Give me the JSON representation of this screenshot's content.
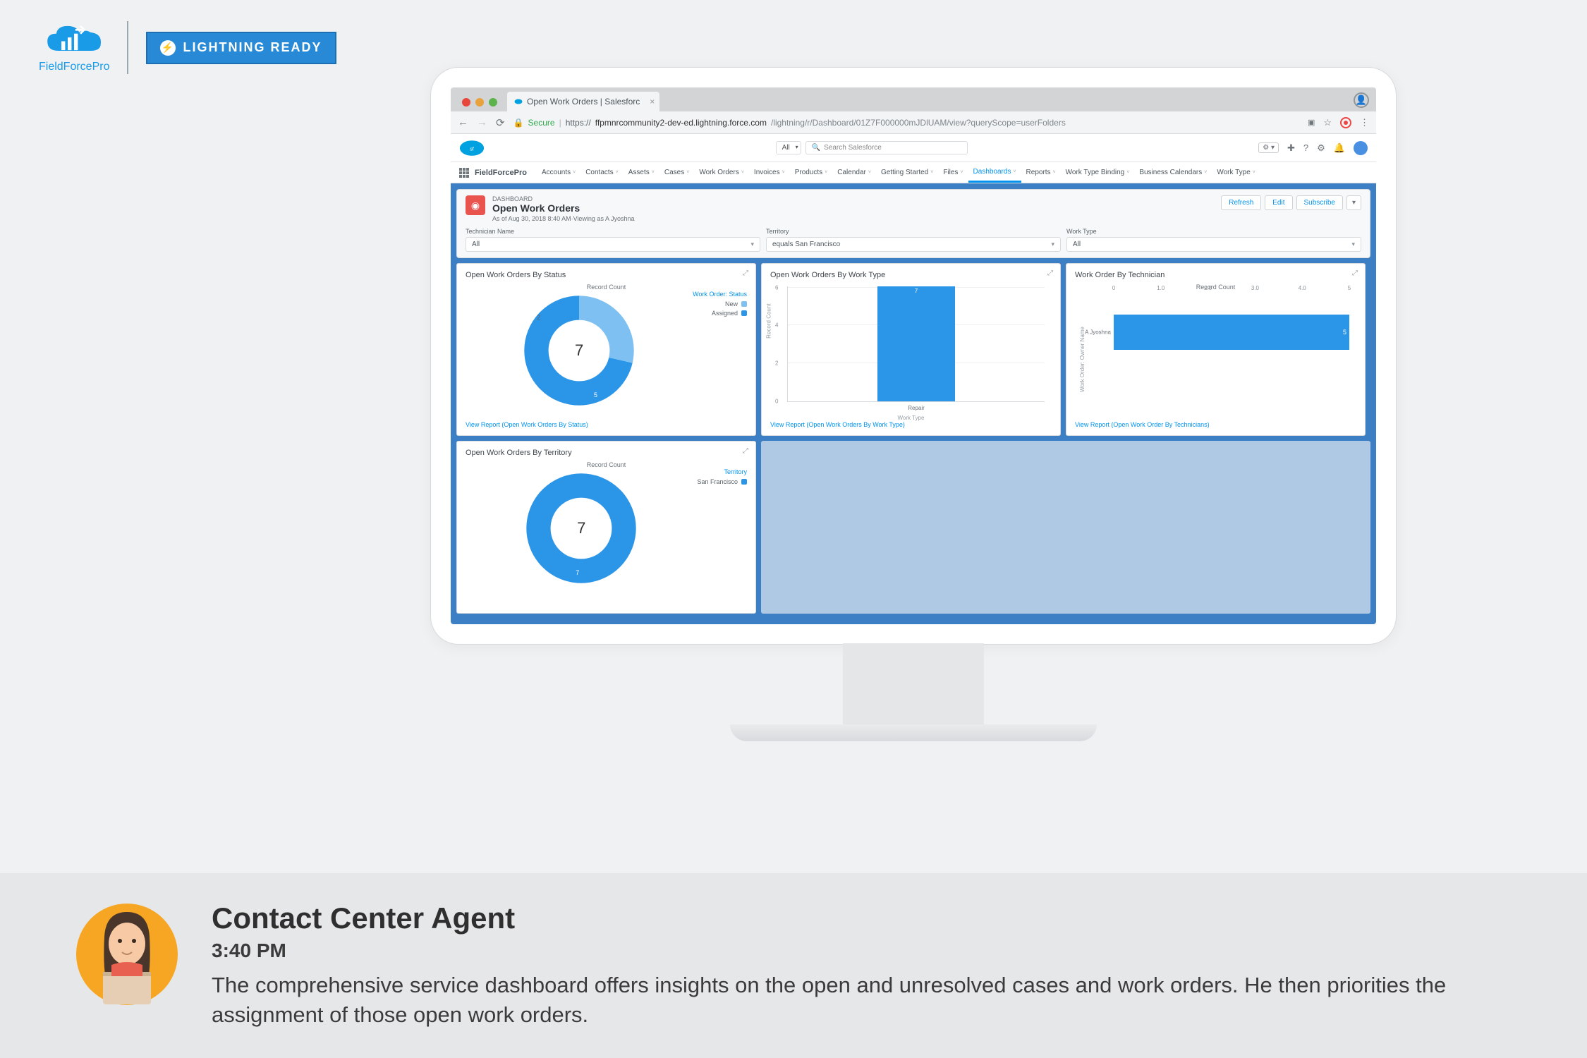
{
  "brand": {
    "name": "FieldForcePro",
    "badge": "LIGHTNING READY"
  },
  "browser": {
    "tab_title": "Open Work Orders | Salesforc",
    "url_secure_label": "Secure",
    "url_host": "ffpmnrcommunity2-dev-ed.lightning.force.com",
    "url_path": "/lightning/r/Dashboard/01Z7F000000mJDlUAM/view?queryScope=userFolders"
  },
  "sf_header": {
    "search_all": "All",
    "search_placeholder": "Search Salesforce",
    "setup_pill": "⚙ ▾"
  },
  "sf_nav": {
    "app": "FieldForcePro",
    "items": [
      "Accounts",
      "Contacts",
      "Assets",
      "Cases",
      "Work Orders",
      "Invoices",
      "Products",
      "Calendar",
      "Getting Started",
      "Files",
      "Dashboards",
      "Reports",
      "Work Type Binding",
      "Business Calendars",
      "Work Type"
    ],
    "active_index": 10
  },
  "dashboard": {
    "kicker": "DASHBOARD",
    "title": "Open Work Orders",
    "subtitle": "As of Aug 30, 2018 8:40 AM·Viewing as A Jyoshna",
    "actions": {
      "refresh": "Refresh",
      "edit": "Edit",
      "subscribe": "Subscribe"
    },
    "filters": [
      {
        "label": "Technician Name",
        "value": "All"
      },
      {
        "label": "Territory",
        "value": "equals San Francisco"
      },
      {
        "label": "Work Type",
        "value": "All"
      }
    ]
  },
  "cards": {
    "status": {
      "title": "Open Work Orders By Status",
      "metric_label": "Record Count",
      "legend_title": "Work Order: Status",
      "link": "View Report (Open Work Orders By Status)",
      "total": "7",
      "segments": [
        {
          "label": "New",
          "value": 2,
          "color": "#7ec0f2"
        },
        {
          "label": "Assigned",
          "value": 5,
          "color": "#2b95e8"
        }
      ]
    },
    "worktype": {
      "title": "Open Work Orders By Work Type",
      "link": "View Report (Open Work Orders By Work Type)",
      "y_label": "Record Count",
      "x_label": "Work Type",
      "category": "Repair",
      "value": "7",
      "y_ticks": [
        "0",
        "2",
        "4",
        "6"
      ]
    },
    "technician": {
      "title": "Work Order By Technician",
      "metric_label": "Record Count",
      "link": "View Report (Open Work Order By Technicians)",
      "y_label": "Work Order: Owner Name",
      "category": "A Jyoshna",
      "value": "5",
      "x_ticks": [
        "0",
        "1.0",
        "2.0",
        "3.0",
        "4.0",
        "5"
      ]
    },
    "territory": {
      "title": "Open Work Orders By Territory",
      "metric_label": "Record Count",
      "legend_title": "Territory",
      "total": "7",
      "segments": [
        {
          "label": "San Francisco",
          "value": 7,
          "color": "#2b95e8"
        }
      ]
    }
  },
  "chart_data": [
    {
      "type": "pie",
      "title": "Open Work Orders By Status",
      "categories": [
        "New",
        "Assigned"
      ],
      "values": [
        2,
        5
      ],
      "total": 7
    },
    {
      "type": "bar",
      "title": "Open Work Orders By Work Type",
      "categories": [
        "Repair"
      ],
      "values": [
        7
      ],
      "ylabel": "Record Count",
      "xlabel": "Work Type",
      "ylim": [
        0,
        7
      ]
    },
    {
      "type": "bar",
      "title": "Work Order By Technician",
      "orientation": "horizontal",
      "categories": [
        "A Jyoshna"
      ],
      "values": [
        5
      ],
      "xlabel": "Record Count",
      "ylabel": "Work Order: Owner Name",
      "xlim": [
        0,
        5
      ]
    },
    {
      "type": "pie",
      "title": "Open Work Orders By Territory",
      "categories": [
        "San Francisco"
      ],
      "values": [
        7
      ],
      "total": 7
    }
  ],
  "caption": {
    "persona": "Contact Center Agent",
    "time": "3:40 PM",
    "message": "The comprehensive service dashboard offers insights on the open and unresolved cases and work orders. He then priorities the assignment of those open work orders."
  },
  "colors": {
    "accent": "#2b95e8",
    "nav_blue": "#0093ee"
  }
}
